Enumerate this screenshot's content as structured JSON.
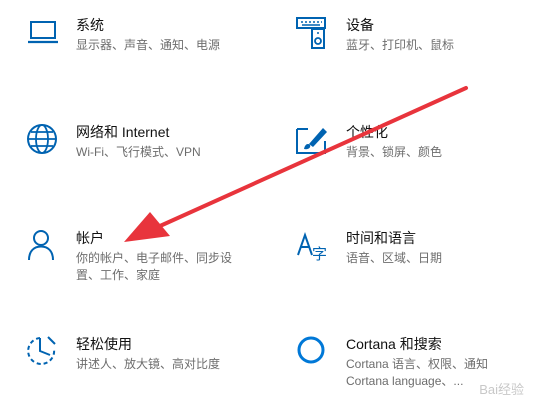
{
  "accent_color": "#0063b1",
  "arrow_color": "#e8343c",
  "tiles": [
    {
      "title": "系统",
      "desc": [
        "显示器、声音、通知、电源"
      ],
      "icon": "laptop-icon"
    },
    {
      "title": "设备",
      "desc": [
        "蓝牙、打印机、鼠标"
      ],
      "icon": "devices-icon"
    },
    {
      "title": "网络和 Internet",
      "desc": [
        "Wi-Fi、飞行模式、VPN"
      ],
      "icon": "globe-icon"
    },
    {
      "title": "个性化",
      "desc": [
        "背景、锁屏、颜色"
      ],
      "icon": "personalization-icon"
    },
    {
      "title": "帐户",
      "desc": [
        "你的帐户、电子邮件、同步设",
        "置、工作、家庭"
      ],
      "icon": "person-icon"
    },
    {
      "title": "时间和语言",
      "desc": [
        "语音、区域、日期"
      ],
      "icon": "time-language-icon"
    },
    {
      "title": "轻松使用",
      "desc": [
        "讲述人、放大镜、高对比度"
      ],
      "icon": "ease-of-access-icon"
    },
    {
      "title": "Cortana 和搜索",
      "desc": [
        "Cortana 语言、权限、通知",
        "Cortana language、..."
      ],
      "icon": "cortana-icon"
    }
  ],
  "watermark": "Bai经验"
}
